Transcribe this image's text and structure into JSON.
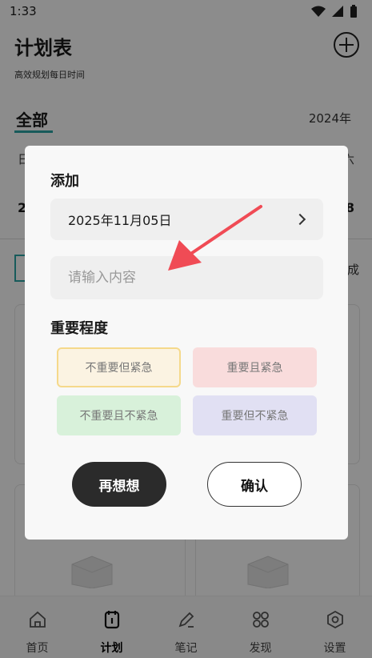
{
  "status_bar": {
    "time": "1:33"
  },
  "header": {
    "title": "计划表",
    "subtitle": "高效规划每日时间"
  },
  "tabs": {
    "all": "全部",
    "year": "2024年"
  },
  "calendar": {
    "left_day": "日",
    "right_day": "六",
    "left_num": "2",
    "right_num": "8"
  },
  "section": {
    "done_label": "成"
  },
  "bottom_nav": [
    {
      "label": "首页",
      "icon": "home-icon"
    },
    {
      "label": "计划",
      "icon": "plan-icon"
    },
    {
      "label": "笔记",
      "icon": "note-icon"
    },
    {
      "label": "发现",
      "icon": "discover-icon"
    },
    {
      "label": "设置",
      "icon": "settings-icon"
    }
  ],
  "dialog": {
    "title": "添加",
    "date": "2025年11月05日",
    "content_placeholder": "请输入内容",
    "importance_title": "重要程度",
    "priorities": [
      "不重要但紧急",
      "重要且紧急",
      "不重要且不紧急",
      "重要但不紧急"
    ],
    "cancel_label": "再想想",
    "confirm_label": "确认"
  },
  "colors": {
    "accent": "#2aa7a7",
    "arrow": "#f04b55",
    "urgent_border": "#f5d98b"
  }
}
